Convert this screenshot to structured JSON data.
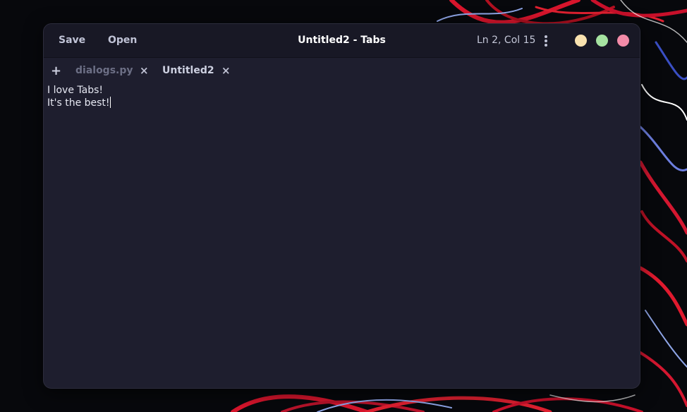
{
  "window": {
    "title": "Untitled2 - Tabs",
    "cursor_position": "Ln 2, Col 15"
  },
  "headerbar": {
    "save_label": "Save",
    "open_label": "Open"
  },
  "tabs": {
    "new_tab_symbol": "+",
    "close_symbol": "×",
    "items": [
      {
        "label": "dialogs.py",
        "active": false
      },
      {
        "label": "Untitled2",
        "active": true
      }
    ]
  },
  "editor": {
    "lines": [
      "I love Tabs!",
      "It's the best!"
    ]
  },
  "colors": {
    "window_bg": "#1e1e2e",
    "headerbar_bg": "#181825",
    "minimize": "#f9e2af",
    "maximize": "#a6e3a1",
    "close": "#f38ba8"
  },
  "icons": {
    "menu": "vertical-dots-icon",
    "new_tab": "plus-icon",
    "tab_close": "close-icon"
  }
}
